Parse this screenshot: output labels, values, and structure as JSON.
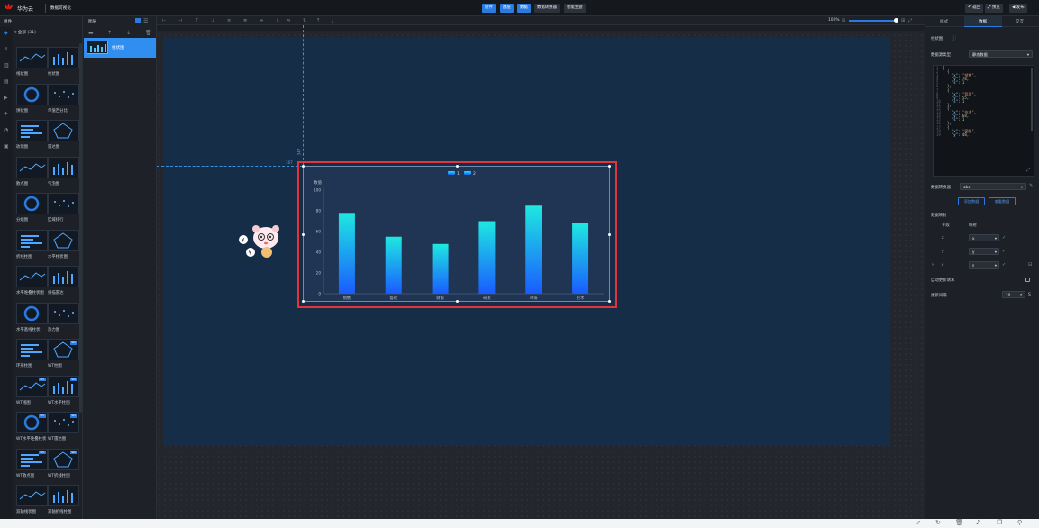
{
  "header": {
    "brand": "华为云",
    "product": "数据可视化",
    "tabs": [
      {
        "label": "组件",
        "active": true
      },
      {
        "label": "图层",
        "active": true
      },
      {
        "label": "数据",
        "active": true
      },
      {
        "label": "数据转换器",
        "active": false
      },
      {
        "label": "智能主题",
        "active": false
      }
    ],
    "actions": [
      "返回",
      "预览",
      "发布"
    ]
  },
  "left_panel": {
    "title": "组件",
    "group": "全部 (31)",
    "components": [
      {
        "label": "线状图",
        "badge": ""
      },
      {
        "label": "柱状图",
        "badge": ""
      },
      {
        "label": "饼状图",
        "badge": ""
      },
      {
        "label": "单值百分比",
        "badge": ""
      },
      {
        "label": "玫瑰图",
        "badge": ""
      },
      {
        "label": "雷达图",
        "badge": ""
      },
      {
        "label": "散点图",
        "badge": ""
      },
      {
        "label": "气泡图",
        "badge": ""
      },
      {
        "label": "分组图",
        "badge": ""
      },
      {
        "label": "区域排行",
        "badge": ""
      },
      {
        "label": "折线柱图",
        "badge": ""
      },
      {
        "label": "水平柱状图",
        "badge": ""
      },
      {
        "label": "水平堆叠柱状图",
        "badge": ""
      },
      {
        "label": "扫描雷达",
        "badge": ""
      },
      {
        "label": "水平基线柱状",
        "badge": ""
      },
      {
        "label": "热力图",
        "badge": ""
      },
      {
        "label": "环形柱图",
        "badge": ""
      },
      {
        "label": "WT柱图",
        "badge": "WT"
      },
      {
        "label": "WT线图",
        "badge": "WT"
      },
      {
        "label": "WT水平柱图",
        "badge": "WT"
      },
      {
        "label": "WT水平堆叠柱状",
        "badge": "WT"
      },
      {
        "label": "WT雷达图",
        "badge": "WT"
      },
      {
        "label": "WT散点图",
        "badge": "WT"
      },
      {
        "label": "WT折线柱图",
        "badge": "WT"
      },
      {
        "label": "双轴线状图",
        "badge": ""
      },
      {
        "label": "双轴折线柱图",
        "badge": ""
      }
    ]
  },
  "layers": {
    "title": "图层",
    "items": [
      {
        "label": "柱状图",
        "selected": true
      }
    ]
  },
  "toolbar": {
    "zoom": "100%"
  },
  "canvas": {
    "guide_x": "347",
    "guide_y": "167"
  },
  "chart_data": {
    "type": "bar",
    "categories": [
      "销售",
      "管理",
      "财报",
      "研发",
      "市场",
      "技术"
    ],
    "values": [
      78,
      55,
      48,
      70,
      85,
      68
    ],
    "ylabel": "数值",
    "ylim": [
      0,
      100
    ],
    "yticks": [
      "0",
      "20",
      "40",
      "60",
      "80",
      "100"
    ],
    "legend": [
      "1",
      "2"
    ],
    "colors": {
      "top": "#1ee8e0",
      "bottom": "#1a5cff"
    }
  },
  "right_panel": {
    "tabs": [
      "样式",
      "数据",
      "交互"
    ],
    "active_tab": "数据",
    "component_name": "柱状图",
    "source_label": "数据源类型",
    "source_value": "静态数据",
    "json_lines": [
      "1  [",
      "2    {",
      "3      \"x\": \"销售\",",
      "4      \"y\": 78,",
      "5      \"s\": 1",
      "6    },",
      "7    {",
      "8      \"x\": \"管理\",",
      "9      \"y\": 55,",
      "10     \"s\": 1",
      "11   },",
      "12   {",
      "13     \"x\": \"技术\",",
      "14     \"y\": 68,",
      "15     \"s\": 1",
      "16   },",
      "17   {",
      "18     \"x\": \"客服\",",
      "19     \"y\": 48,"
    ],
    "converter_label": "数据转换器",
    "converter_value": "obs",
    "btn_add": "添加数据",
    "btn_view": "查看数据",
    "mapping_title": "数据映射",
    "mapping_head": [
      "字段",
      "映射"
    ],
    "mapping_rows": [
      {
        "field": "x",
        "map": "x"
      },
      {
        "field": "y",
        "map": "y"
      },
      {
        "field": "s",
        "map": "s"
      }
    ],
    "auto_label": "自动更新请求",
    "interval_label": "更新间隔",
    "interval_value": "10",
    "interval_unit": "S"
  }
}
